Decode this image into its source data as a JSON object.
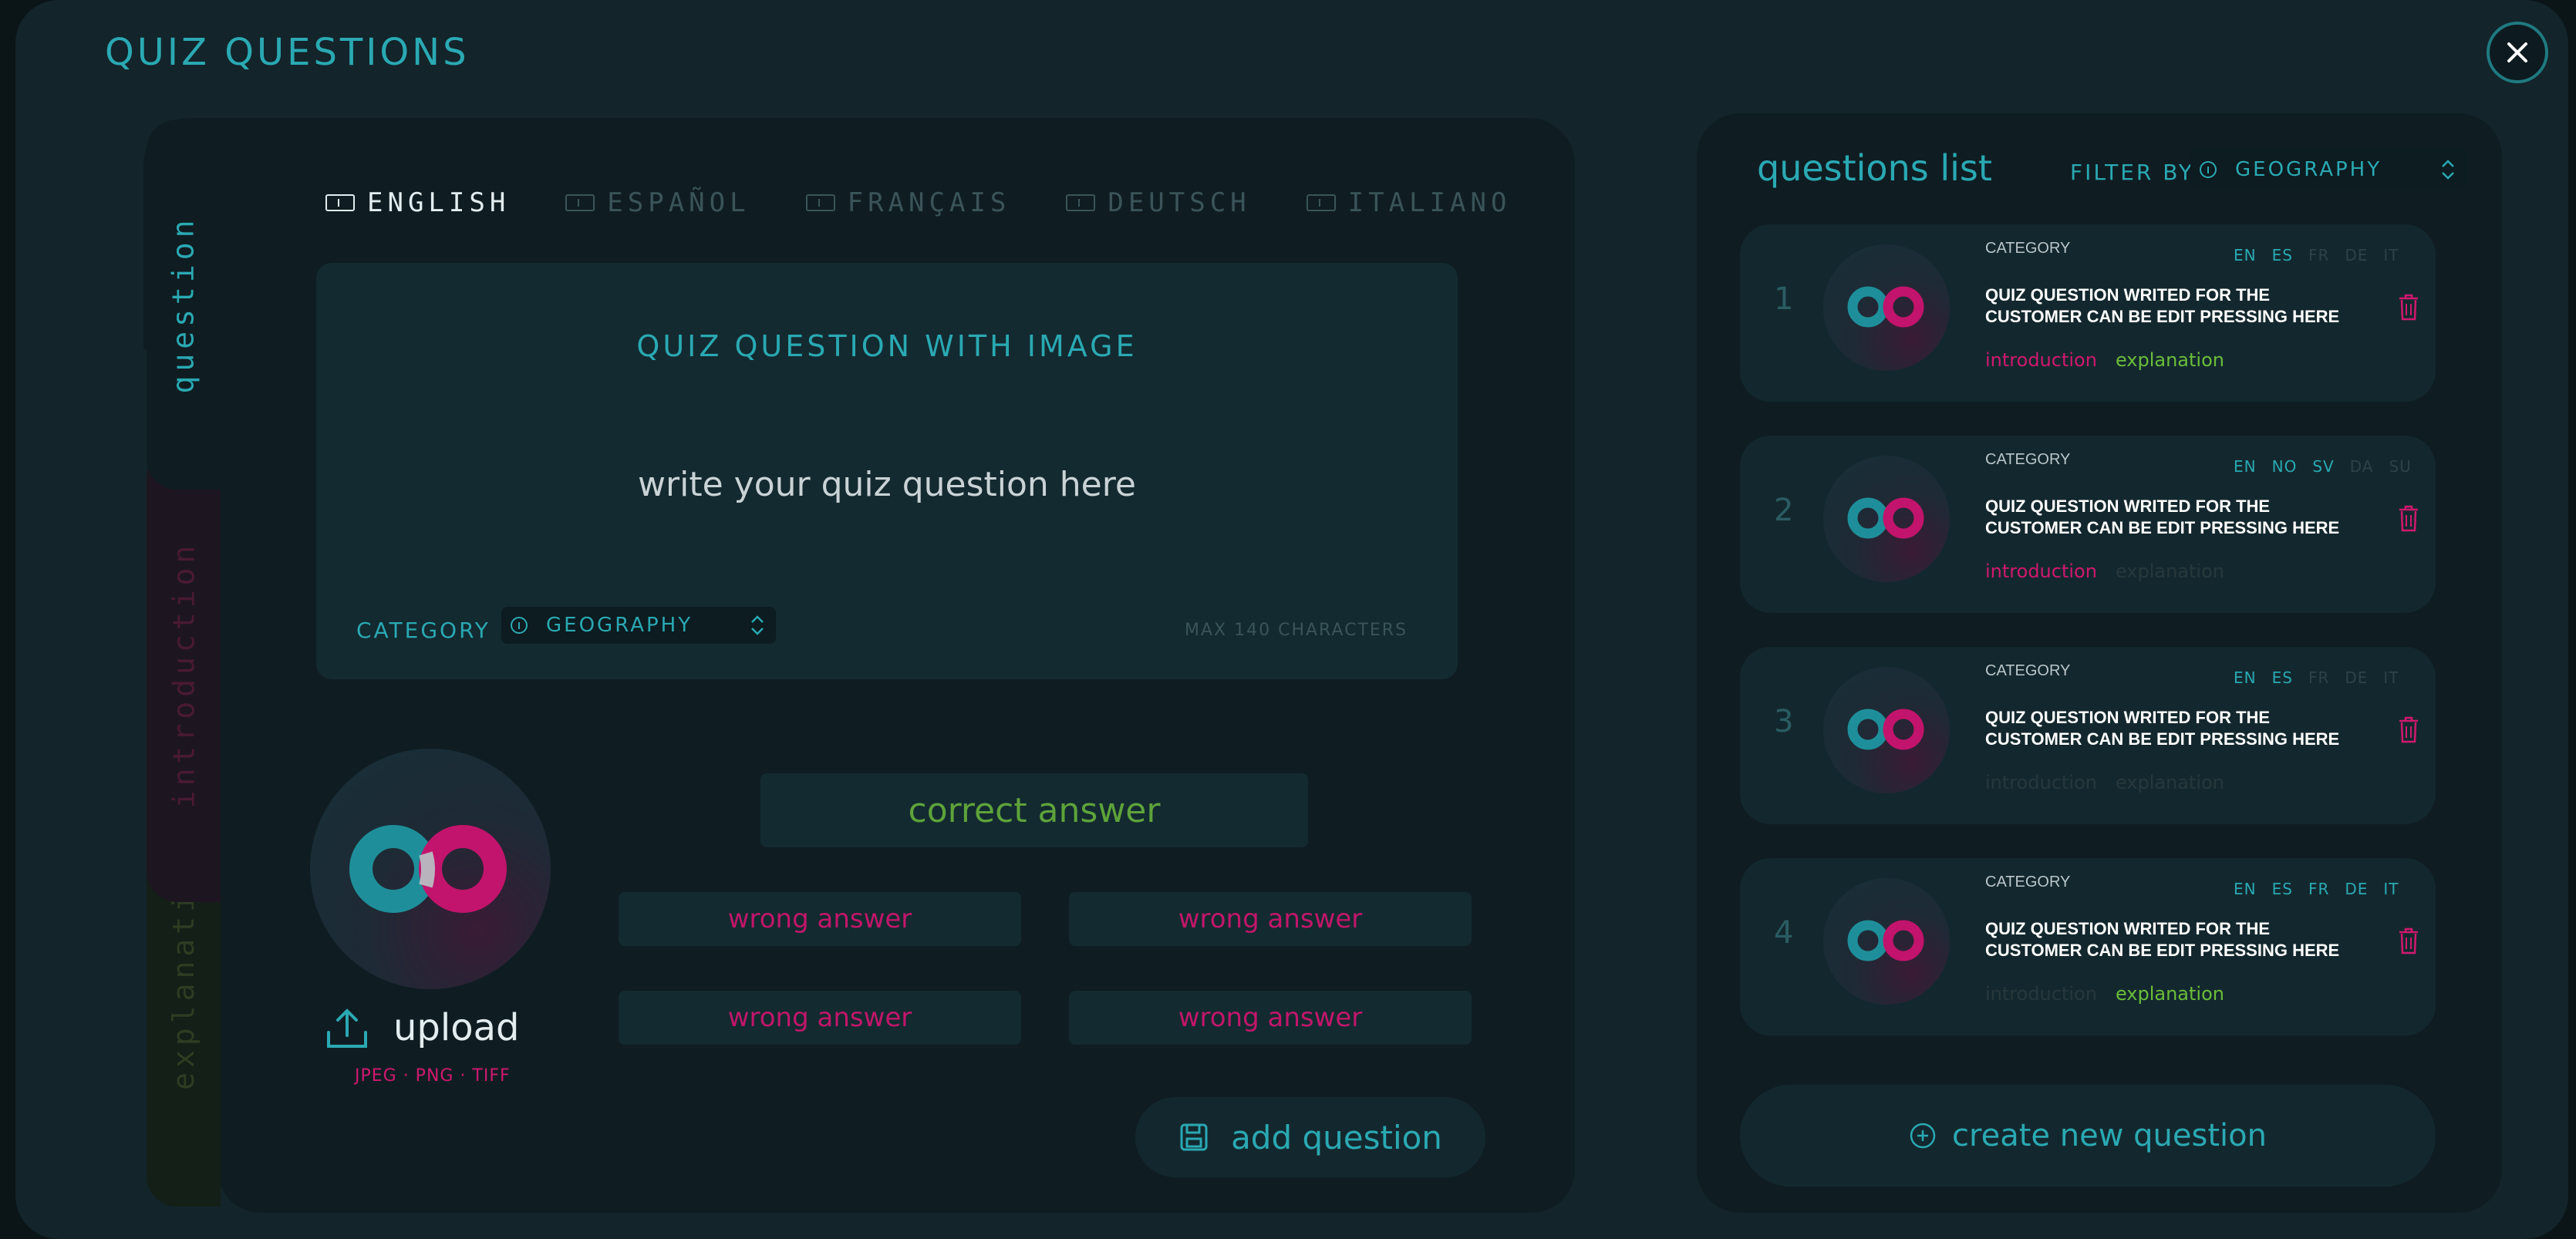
{
  "window": {
    "title": "QUIZ QUESTIONS"
  },
  "languages": [
    {
      "label": "ENGLISH",
      "active": true
    },
    {
      "label": "ESPAÑOL",
      "active": false
    },
    {
      "label": "FRANÇAIS",
      "active": false
    },
    {
      "label": "DEUTSCH",
      "active": false
    },
    {
      "label": "ITALIANO",
      "active": false
    }
  ],
  "side_tabs": {
    "question": "question",
    "introduction": "introduction",
    "explanation": "explanation"
  },
  "editor": {
    "heading": "QUIZ QUESTION WITH IMAGE",
    "placeholder": "write your quiz question here",
    "category_label": "CATEGORY",
    "category_value": "GEOGRAPHY",
    "max_chars": "MAX 140 CHARACTERS",
    "upload_label": "upload",
    "file_types": "JPEG · PNG · TIFF",
    "correct_answer": "correct answer",
    "wrong_answers": [
      "wrong answer",
      "wrong  answer",
      "wrong answer",
      "wrong  answer"
    ],
    "add_button": "add question"
  },
  "list": {
    "title": "questions list",
    "filter_label": "FILTER BY",
    "filter_value": "GEOGRAPHY",
    "create_button": "create new question",
    "items": [
      {
        "num": "1",
        "category": "CATEGORY",
        "text": "QUIZ QUESTION WRITED FOR THE CUSTOMER CAN BE EDIT PRESSING HERE",
        "langs": [
          [
            "EN",
            true
          ],
          [
            "ES",
            true
          ],
          [
            "FR",
            false
          ],
          [
            "DE",
            false
          ],
          [
            "IT",
            false
          ]
        ],
        "intro": "introduction",
        "intro_on": true,
        "expl": "explanation",
        "expl_on": true
      },
      {
        "num": "2",
        "category": "CATEGORY",
        "text": "QUIZ QUESTION WRITED FOR THE CUSTOMER CAN BE EDIT PRESSING HERE",
        "langs": [
          [
            "EN",
            true
          ],
          [
            "NO",
            true
          ],
          [
            "SV",
            true
          ],
          [
            "DA",
            false
          ],
          [
            "SU",
            false
          ]
        ],
        "intro": "introduction",
        "intro_on": true,
        "expl": "explanation",
        "expl_on": false
      },
      {
        "num": "3",
        "category": "CATEGORY",
        "text": "QUIZ QUESTION WRITED FOR THE CUSTOMER CAN BE EDIT PRESSING HERE",
        "langs": [
          [
            "EN",
            true
          ],
          [
            "ES",
            true
          ],
          [
            "FR",
            false
          ],
          [
            "DE",
            false
          ],
          [
            "IT",
            false
          ]
        ],
        "intro": "introduction",
        "intro_on": false,
        "expl": "explanation",
        "expl_on": false
      },
      {
        "num": "4",
        "category": "CATEGORY",
        "text": "QUIZ QUESTION WRITED FOR THE CUSTOMER CAN BE EDIT PRESSING HERE",
        "langs": [
          [
            "EN",
            true
          ],
          [
            "ES",
            true
          ],
          [
            "FR",
            true
          ],
          [
            "DE",
            true
          ],
          [
            "IT",
            true
          ]
        ],
        "intro": "introduction",
        "intro_on": false,
        "expl": "explanation",
        "expl_on": true
      }
    ]
  },
  "colors": {
    "accent": "#2aa9b3",
    "magenta": "#d0186f",
    "green": "#5ea33a",
    "background": "#13242a"
  }
}
